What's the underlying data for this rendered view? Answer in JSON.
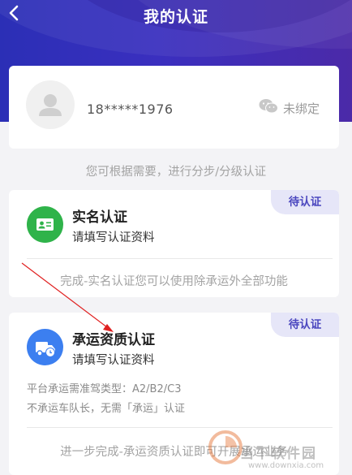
{
  "header": {
    "title": "我的认证"
  },
  "profile": {
    "phone": "18*****1976",
    "wechat_status": "未绑定"
  },
  "hint": "您可根据需要，进行分步/分级认证",
  "cards": [
    {
      "badge": "待认证",
      "title": "实名认证",
      "subtitle": "请填写认证资料",
      "footer": "完成-实名认证您可以使用除承运外全部功能"
    },
    {
      "badge": "待认证",
      "title": "承运资质认证",
      "subtitle": "请填写认证资料",
      "desc_line1": "平台承运需准驾类型：A2/B2/C3",
      "desc_line2": "不承运车队长，无需「承运」认证",
      "footer": "进一步完成-承运资质认证即可开展承运业务"
    }
  ],
  "watermark": {
    "text": "当下软件园",
    "url": "www.downxia.com"
  },
  "colors": {
    "header": "#3a2fbf",
    "badge_bg": "#e6e6f8",
    "badge_text": "#4b47bf",
    "icon_green": "#2fb34a",
    "icon_blue": "#3c7ff0",
    "arrow": "#e02020"
  }
}
